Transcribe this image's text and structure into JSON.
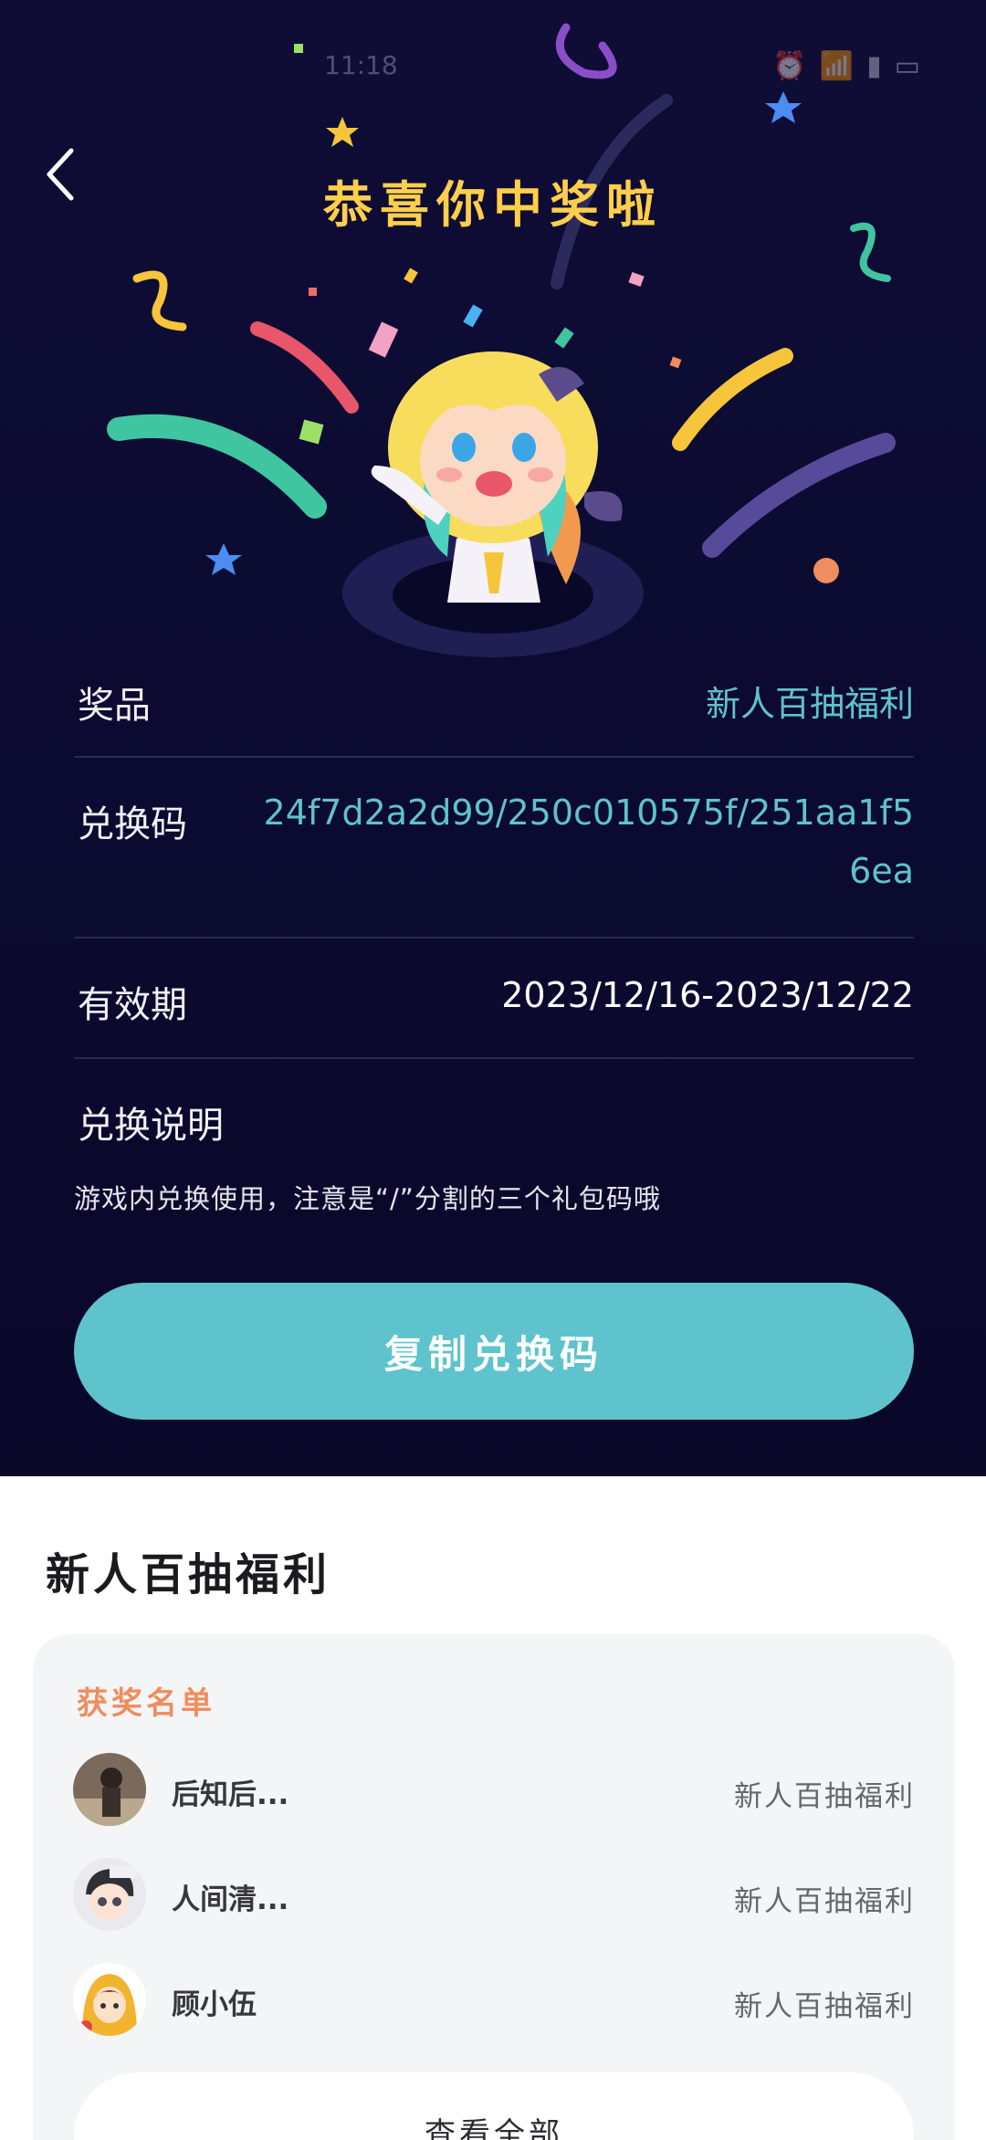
{
  "status_bar": {
    "time": "11:18",
    "icons": [
      "alarm-icon",
      "wifi-icon",
      "signal-icon",
      "battery-icon"
    ]
  },
  "header": {
    "title": "恭喜你中奖啦"
  },
  "prize": {
    "label": "奖品",
    "value": "新人百抽福利"
  },
  "code": {
    "label": "兑换码",
    "line1": "24f7d2a2d99/250c010575f/251aa1f5",
    "line2": "6ea"
  },
  "validity": {
    "label": "有效期",
    "value": "2023/12/16-2023/12/22"
  },
  "instructions": {
    "title": "兑换说明",
    "text": "游戏内兑换使用，注意是“/”分割的三个礼包码哦"
  },
  "copy_button": {
    "label": "复制兑换码"
  },
  "section": {
    "title": "新人百抽福利"
  },
  "winners": {
    "title": "获奖名单",
    "items": [
      {
        "name": "后知后...",
        "prize": "新人百抽福利"
      },
      {
        "name": "人间清...",
        "prize": "新人百抽福利"
      },
      {
        "name": "顾小伍",
        "prize": "新人百抽福利"
      }
    ],
    "view_all": "查看全部"
  },
  "colors": {
    "panel_bg": "#0f0d36",
    "accent_teal": "#5ec3cc",
    "headline_yellow": "#ffcf4a",
    "winners_orange": "#ef8d5e"
  }
}
